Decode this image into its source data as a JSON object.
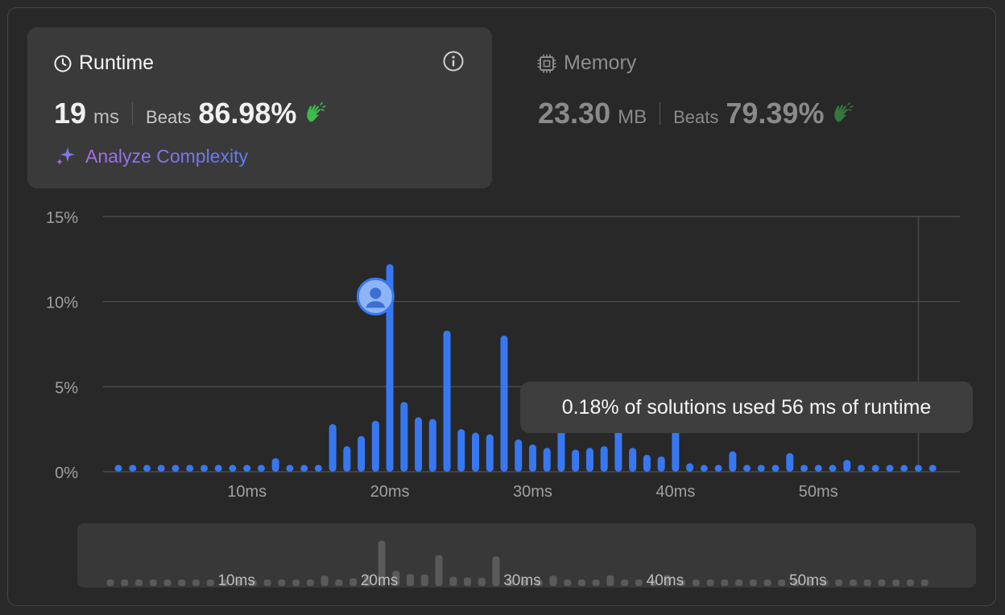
{
  "runtime": {
    "title": "Runtime",
    "value": "19",
    "unit": "ms",
    "beats_label": "Beats",
    "beats_pct": "86.98%",
    "analyze_label": "Analyze Complexity"
  },
  "memory": {
    "title": "Memory",
    "value": "23.30",
    "unit": "MB",
    "beats_label": "Beats",
    "beats_pct": "79.39%"
  },
  "tooltip": "0.18% of solutions used 56 ms of runtime",
  "colors": {
    "bar": "#3778f2",
    "accent_green": "#3dbb4b",
    "grid": "#4a4a4a",
    "brush_bar": "#5a5a5a"
  },
  "chart_data": {
    "type": "bar",
    "x": [
      1,
      2,
      3,
      4,
      5,
      6,
      7,
      8,
      9,
      10,
      11,
      12,
      13,
      14,
      15,
      16,
      17,
      18,
      19,
      20,
      21,
      22,
      23,
      24,
      25,
      26,
      27,
      28,
      29,
      30,
      31,
      32,
      33,
      34,
      35,
      36,
      37,
      38,
      39,
      40,
      41,
      42,
      43,
      44,
      45,
      46,
      47,
      48,
      49,
      50,
      51,
      52,
      53,
      54,
      55,
      56,
      57,
      58
    ],
    "values": [
      0.4,
      0.4,
      0.4,
      0.4,
      0.4,
      0.4,
      0.4,
      0.4,
      0.4,
      0.4,
      0.4,
      0.8,
      0.4,
      0.4,
      0.4,
      2.8,
      1.5,
      2.1,
      3.0,
      12.2,
      4.1,
      3.2,
      3.1,
      8.3,
      2.5,
      2.3,
      2.2,
      8.0,
      1.9,
      1.6,
      1.4,
      2.8,
      1.3,
      1.4,
      1.5,
      2.9,
      1.4,
      1.0,
      0.9,
      3.0,
      0.5,
      0.4,
      0.4,
      1.2,
      0.4,
      0.4,
      0.4,
      1.1,
      0.4,
      0.4,
      0.4,
      0.7,
      0.4,
      0.4,
      0.4,
      0.4,
      0.4,
      0.4
    ],
    "x_ticks": [
      "10ms",
      "20ms",
      "30ms",
      "40ms",
      "50ms"
    ],
    "x_tick_values": [
      10,
      20,
      30,
      40,
      50
    ],
    "y_ticks": [
      "15%",
      "10%",
      "5%",
      "0%"
    ],
    "y_tick_values": [
      15,
      10,
      5,
      0
    ],
    "ylim": [
      0,
      15
    ],
    "xlim": [
      0,
      60
    ],
    "highlight_x": 20,
    "highlight_value": 10.3,
    "hover_x": 57,
    "grid": true
  },
  "brush_chart": {
    "x_ticks": [
      "10ms",
      "20ms",
      "30ms",
      "40ms",
      "50ms"
    ]
  }
}
